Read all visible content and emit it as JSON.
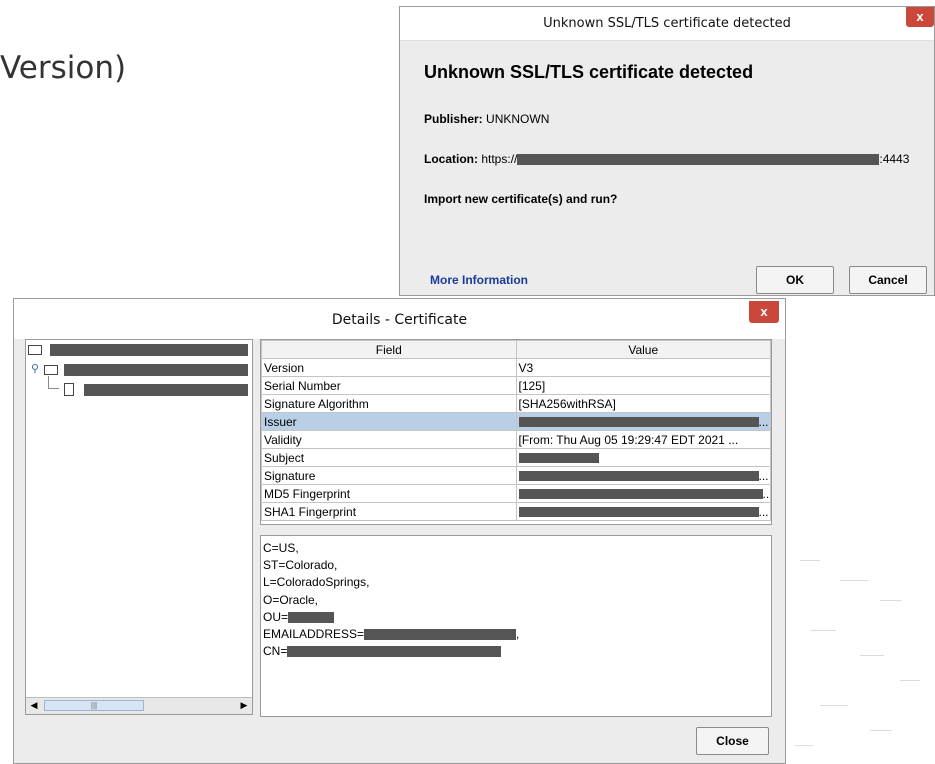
{
  "background": {
    "title": "Version)"
  },
  "ssl_dialog": {
    "window_title": "Unknown SSL/TLS certificate detected",
    "close_label": "x",
    "heading": "Unknown SSL/TLS certificate detected",
    "publisher_label": "Publisher:",
    "publisher_value": "UNKNOWN",
    "location_label": "Location:",
    "location_prefix": "https://",
    "location_suffix": ":4443",
    "question": "Import new certificate(s) and run?",
    "more_info": "More Information",
    "ok_label": "OK",
    "cancel_label": "Cancel"
  },
  "details_dialog": {
    "window_title": "Details - Certificate",
    "close_label": "x",
    "table": {
      "headers": [
        "Field",
        "Value"
      ],
      "rows": [
        {
          "field": "Version",
          "value": "V3"
        },
        {
          "field": "Serial Number",
          "value": "[125]"
        },
        {
          "field": "Signature Algorithm",
          "value": "[SHA256withRSA]"
        },
        {
          "field": "Issuer",
          "value": ""
        },
        {
          "field": "Validity",
          "value": "[From: Thu Aug 05 19:29:47 EDT 2021 ..."
        },
        {
          "field": "Subject",
          "value": ""
        },
        {
          "field": "Signature",
          "value": ""
        },
        {
          "field": "MD5 Fingerprint",
          "value": ""
        },
        {
          "field": "SHA1 Fingerprint",
          "value": ""
        }
      ],
      "selected_row": "Issuer"
    },
    "detail_lines": {
      "c": "C=US,",
      "st": "ST=Colorado,",
      "l": "L=ColoradoSprings,",
      "o": "O=Oracle,",
      "ou": "OU=",
      "email": "EMAILADDRESS=",
      "email_trail": ",",
      "cn": "CN="
    },
    "close_button": "Close"
  }
}
